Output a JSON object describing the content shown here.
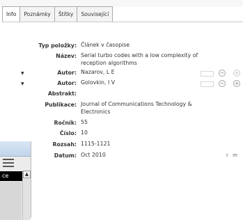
{
  "tabs": [
    {
      "label": "Info",
      "active": true
    },
    {
      "label": "Poznámky",
      "active": false
    },
    {
      "label": "Štítky",
      "active": false
    },
    {
      "label": "Související",
      "active": false
    }
  ],
  "fields": {
    "item_type": {
      "label": "Typ položky:",
      "value": "Článek v časopise"
    },
    "title": {
      "label": "Název:",
      "value_line1": "Serial turbo codes with a low complexity of",
      "value_line2": "reception algorithms"
    },
    "author1": {
      "label": "Autor:",
      "value": "Nazarov, L E"
    },
    "author2": {
      "label": "Autor:",
      "value": "Golovkin, I V"
    },
    "abstract": {
      "label": "Abstrakt:",
      "value": ""
    },
    "publication": {
      "label": "Publikace:",
      "value_line1": "Journal of Communications Technology &",
      "value_line2": "Electronics"
    },
    "volume": {
      "label": "Ročník:",
      "value": "55"
    },
    "issue": {
      "label": "Číslo:",
      "value": "10"
    },
    "pages": {
      "label": "Rozsah:",
      "value": "1115-1121"
    },
    "date": {
      "label": "Datum:",
      "value": "Oct 2010",
      "suffix": "r m"
    }
  },
  "background_window": {
    "cell_text": "ce",
    "scroll_up_glyph": "▲"
  },
  "colors": {
    "tab_border": "#a9a9a9",
    "label_text": "#333333",
    "background": "#ffffff"
  }
}
